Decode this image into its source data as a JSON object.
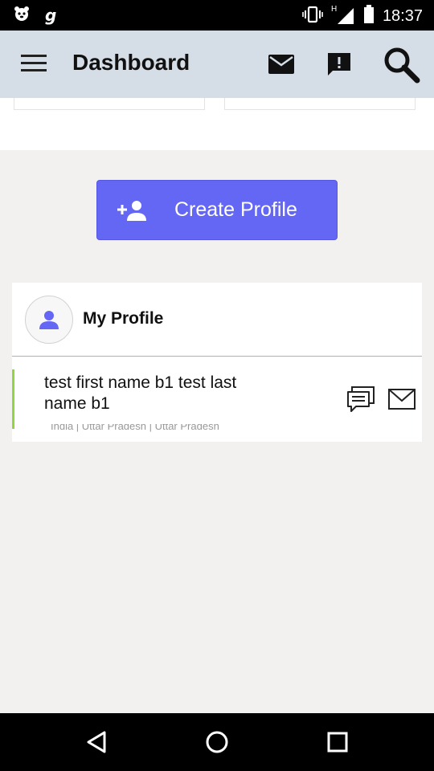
{
  "status_bar": {
    "time": "18:37",
    "carrier_glyph": "g",
    "network_label": "H",
    "icons": [
      "app-notification-icon",
      "vibrate-icon",
      "signal-icon",
      "battery-icon"
    ]
  },
  "app_bar": {
    "title": "Dashboard",
    "icons": [
      "menu-icon",
      "mail-icon",
      "feedback-icon",
      "search-icon"
    ]
  },
  "create_button": {
    "label": "Create Profile",
    "icon": "add-person-icon",
    "color": "#6466f4"
  },
  "profile_card": {
    "title": "My Profile",
    "items": [
      {
        "name": "test first name b1 test last name b1",
        "location": "India | Uttar Pradesh | Uttar Pradesh",
        "accent": "#8fd63f"
      }
    ]
  },
  "nav_bar": {
    "buttons": [
      "back-icon",
      "home-icon",
      "recents-icon"
    ]
  }
}
